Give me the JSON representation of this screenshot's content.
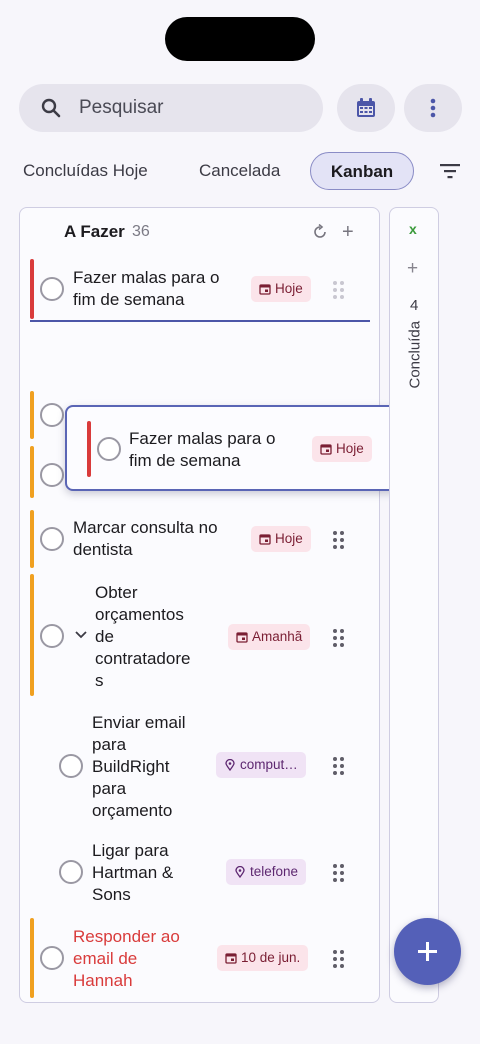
{
  "search": {
    "placeholder": "Pesquisar"
  },
  "tabs": [
    {
      "label": "Concluídas Hoje"
    },
    {
      "label": "Cancelada"
    },
    {
      "label": "Kanban",
      "active": true
    }
  ],
  "column": {
    "title": "A Fazer",
    "count": "36",
    "tasks": [
      {
        "title_lines": [
          "Fazer malas para o",
          "fim de semana"
        ],
        "badge": "Hoje",
        "badge_icon": "calendar-icon",
        "priority_color": "#d93b3b"
      },
      {
        "title_lines": [
          "Marcar consulta no",
          "dentista"
        ],
        "badge": "Hoje",
        "badge_icon": "calendar-icon",
        "priority_color": "#f0a020"
      },
      {
        "title_lines": [
          "Obter",
          "orçamentos",
          "de",
          "contratadore",
          "s"
        ],
        "badge": "Amanhã",
        "badge_icon": "calendar-icon",
        "priority_color": "#f0a020"
      },
      {
        "title_lines": [
          "Enviar email",
          "para",
          "BuildRight",
          "para",
          "orçamento"
        ],
        "badge": "comput…",
        "badge_icon": "location-icon"
      },
      {
        "title_lines": [
          "Ligar para",
          "Hartman &",
          "Sons"
        ],
        "badge": "telefone",
        "badge_icon": "location-icon"
      },
      {
        "title_lines": [
          "Responder ao",
          "email de",
          "Hannah"
        ],
        "badge": "10 de jun.",
        "badge_icon": "calendar-icon",
        "priority_color": "#f0a020",
        "overdue_color": "#d93b3b"
      }
    ]
  },
  "dragging_card": {
    "title_lines": [
      "Fazer malas para o",
      "fim de semana"
    ],
    "badge": "Hoje",
    "priority_color": "#d93b3b"
  },
  "side_column": {
    "close_label": "x",
    "count": "4",
    "title": "Concluída"
  },
  "colors": {
    "accent": "#5460b8",
    "priority_high": "#d93b3b",
    "priority_medium": "#f0a020"
  }
}
